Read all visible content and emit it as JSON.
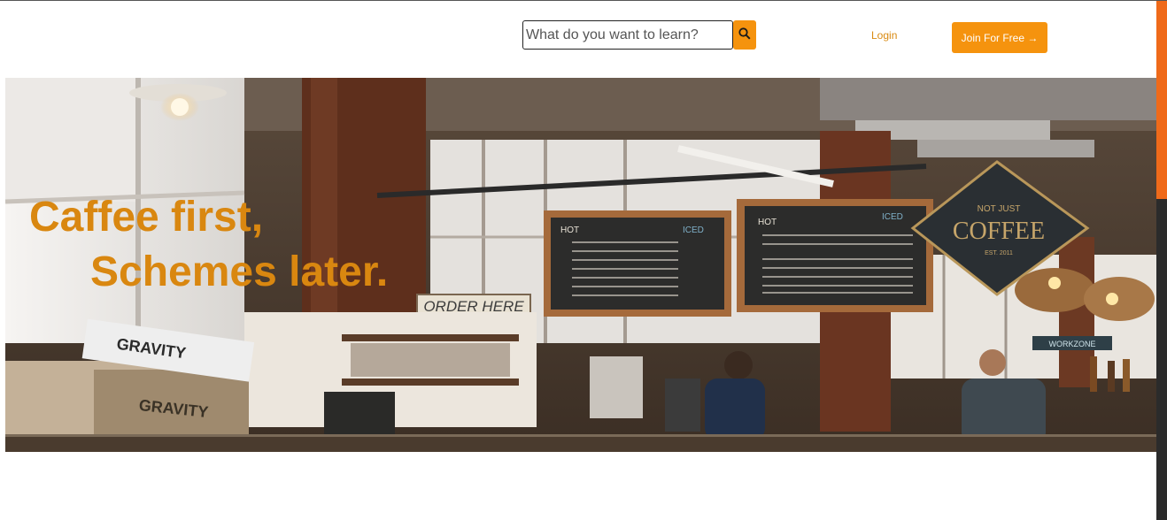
{
  "header": {
    "search": {
      "placeholder": "What do you want to learn?",
      "value": "",
      "button_icon": "search-icon"
    },
    "login_label": "Login",
    "join_label": "Join For Free →"
  },
  "hero": {
    "headline_line1": "Caffee first,",
    "headline_line2": "Schemes later.",
    "photo_signs": {
      "order_here": "ORDER HERE",
      "not_just": "NOT JUST",
      "coffee": "COFFEE",
      "est": "EST. 2011",
      "menu_left_hot": "HOT",
      "menu_left_iced": "ICED",
      "menu_right_hot": "HOT",
      "menu_right_iced": "ICED",
      "gravity": "GRAVITY",
      "workzone": "WORKZONE"
    }
  },
  "colors": {
    "accent": "#f5930e",
    "headline": "#d98710",
    "scroll_thumb": "#ef6a1a"
  }
}
